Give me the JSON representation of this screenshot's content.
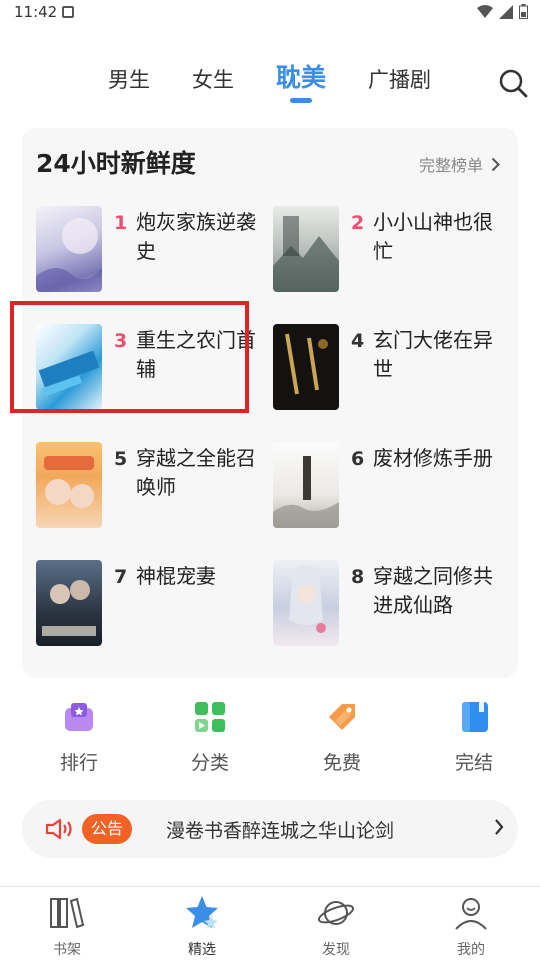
{
  "status_bar": {
    "time": "11:42"
  },
  "top_nav": {
    "tabs": [
      {
        "label": "男生"
      },
      {
        "label": "女生"
      },
      {
        "label": "耽美",
        "active": true
      },
      {
        "label": "广播剧"
      }
    ]
  },
  "ranking": {
    "title": "24小时新鲜度",
    "more_label": "完整榜单",
    "books": [
      {
        "rank": "1",
        "title": "炮灰家族逆袭史"
      },
      {
        "rank": "2",
        "title": "小小山神也很忙"
      },
      {
        "rank": "3",
        "title": "重生之农门首辅"
      },
      {
        "rank": "4",
        "title": "玄门大佬在异世"
      },
      {
        "rank": "5",
        "title": "穿越之全能召唤师"
      },
      {
        "rank": "6",
        "title": "废材修炼手册"
      },
      {
        "rank": "7",
        "title": "神棍宠妻"
      },
      {
        "rank": "8",
        "title": "穿越之同修共进成仙路"
      }
    ]
  },
  "shortcuts": [
    {
      "label": "排行",
      "icon": "ranking-icon"
    },
    {
      "label": "分类",
      "icon": "category-icon"
    },
    {
      "label": "免费",
      "icon": "free-tag-icon"
    },
    {
      "label": "完结",
      "icon": "completed-book-icon"
    }
  ],
  "notice": {
    "badge": "公告",
    "text": "漫卷书香醉连城之华山论剑"
  },
  "bottom_tabs": [
    {
      "label": "书架",
      "icon": "bookshelf-icon"
    },
    {
      "label": "精选",
      "icon": "featured-star-icon",
      "active": true
    },
    {
      "label": "发现",
      "icon": "discover-planet-icon"
    },
    {
      "label": "我的",
      "icon": "profile-icon"
    }
  ],
  "colors": {
    "accent": "#3a8ee6",
    "rank_hot": "#e8506e",
    "notice_badge": "#f06226",
    "highlight": "#e02424"
  }
}
